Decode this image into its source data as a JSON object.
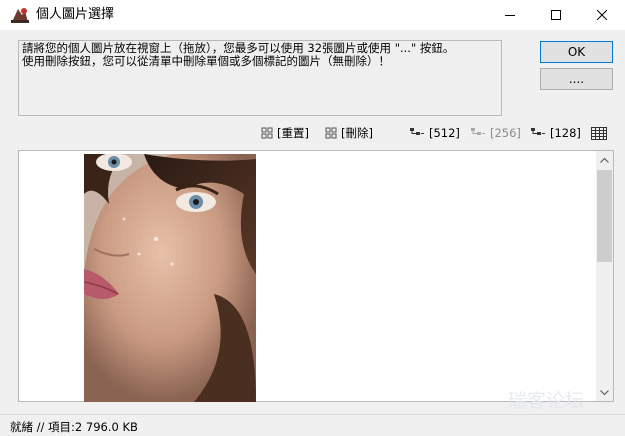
{
  "window": {
    "title": "個人圖片選擇"
  },
  "message": {
    "line1": "請將您的個人圖片放在視窗上（拖放），您最多可以使用 32張圖片或使用 \"...\" 按鈕。",
    "line2": "使用刪除按鈕，您可以從清單中刪除單個或多個標記的圖片（無刪除）！"
  },
  "buttons": {
    "ok": "OK",
    "more": "...."
  },
  "toolbar": {
    "reset": "[重置]",
    "delete": "[刪除]",
    "size_512": "[512]",
    "size_256": "[256]",
    "size_128": "[128]"
  },
  "status": {
    "text": "就緒 // 項目:2 796.0 KB"
  },
  "watermark": "瑞客论坛",
  "colors": {
    "accent": "#0078d7",
    "disabled": "#8c8c8c"
  },
  "icons": {
    "app": "app-logo-icon",
    "minimize": "minimize-icon",
    "maximize": "maximize-icon",
    "close": "close-icon",
    "reset": "grid-icon",
    "delete": "grid-icon",
    "size": "tree-icon",
    "view": "list-view-icon"
  }
}
